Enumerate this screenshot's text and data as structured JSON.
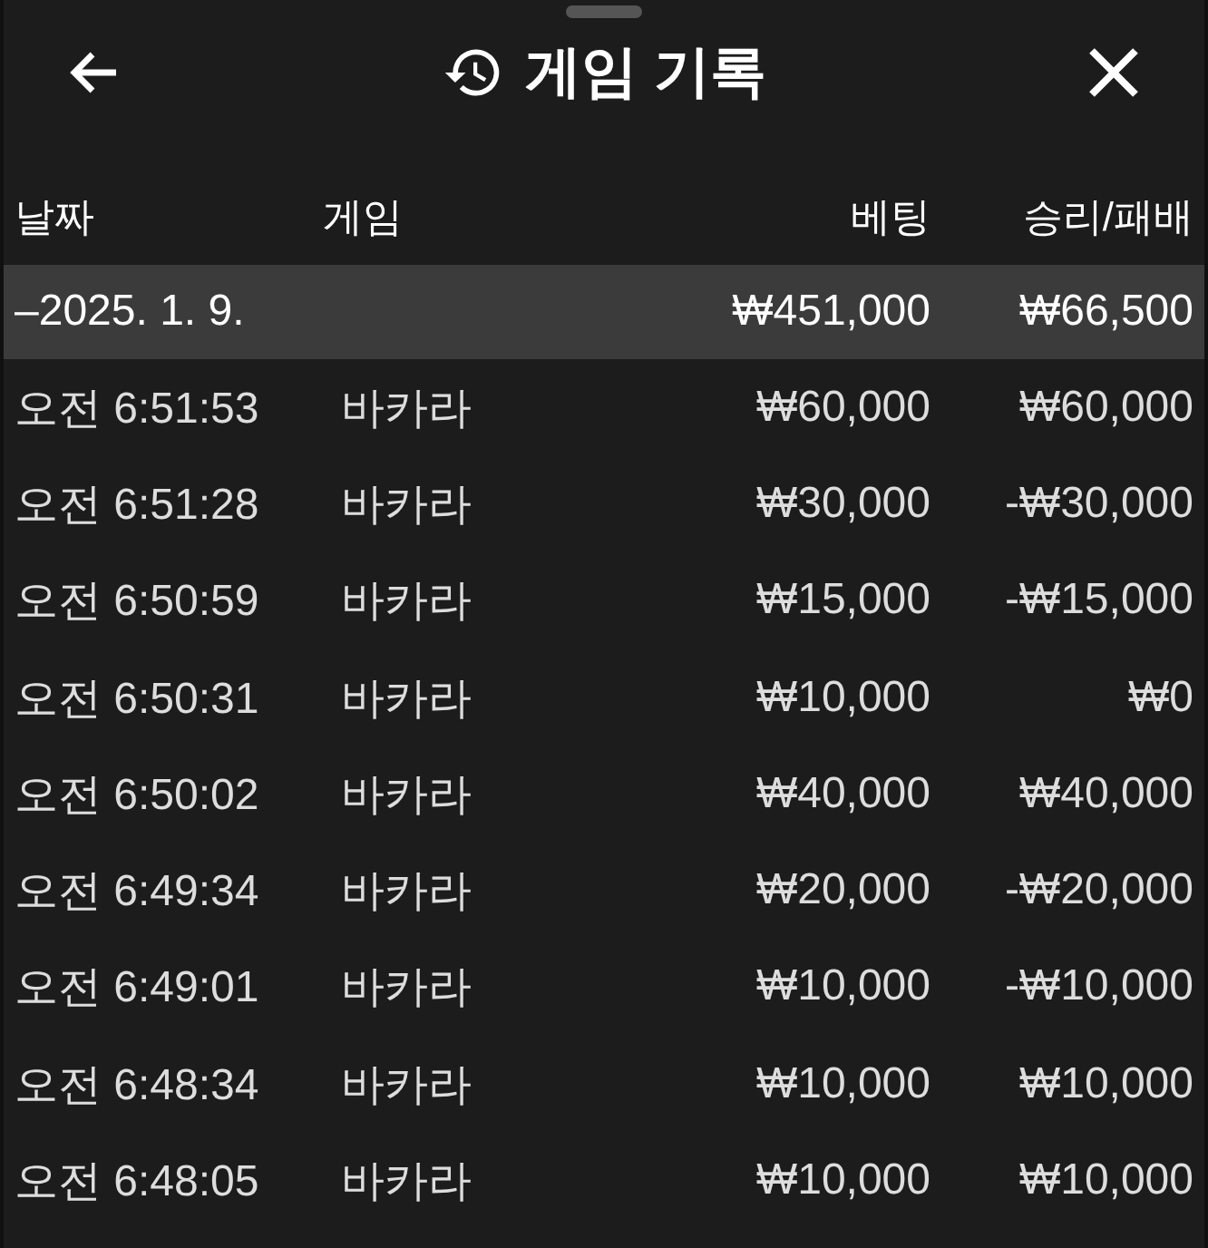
{
  "title": "게임 기록",
  "columns": [
    "날짜",
    "게임",
    "베팅",
    "승리/패배"
  ],
  "summary": {
    "date": "–2025. 1. 9.",
    "bet": "₩451,000",
    "result": "₩66,500"
  },
  "rows": [
    {
      "time": "오전 6:51:53",
      "game": "바카라",
      "bet": "₩60,000",
      "result": "₩60,000"
    },
    {
      "time": "오전 6:51:28",
      "game": "바카라",
      "bet": "₩30,000",
      "result": "-₩30,000"
    },
    {
      "time": "오전 6:50:59",
      "game": "바카라",
      "bet": "₩15,000",
      "result": "-₩15,000"
    },
    {
      "time": "오전 6:50:31",
      "game": "바카라",
      "bet": "₩10,000",
      "result": "₩0"
    },
    {
      "time": "오전 6:50:02",
      "game": "바카라",
      "bet": "₩40,000",
      "result": "₩40,000"
    },
    {
      "time": "오전 6:49:34",
      "game": "바카라",
      "bet": "₩20,000",
      "result": "-₩20,000"
    },
    {
      "time": "오전 6:49:01",
      "game": "바카라",
      "bet": "₩10,000",
      "result": "-₩10,000"
    },
    {
      "time": "오전 6:48:34",
      "game": "바카라",
      "bet": "₩10,000",
      "result": "₩10,000"
    },
    {
      "time": "오전 6:48:05",
      "game": "바카라",
      "bet": "₩10,000",
      "result": "₩10,000"
    }
  ]
}
